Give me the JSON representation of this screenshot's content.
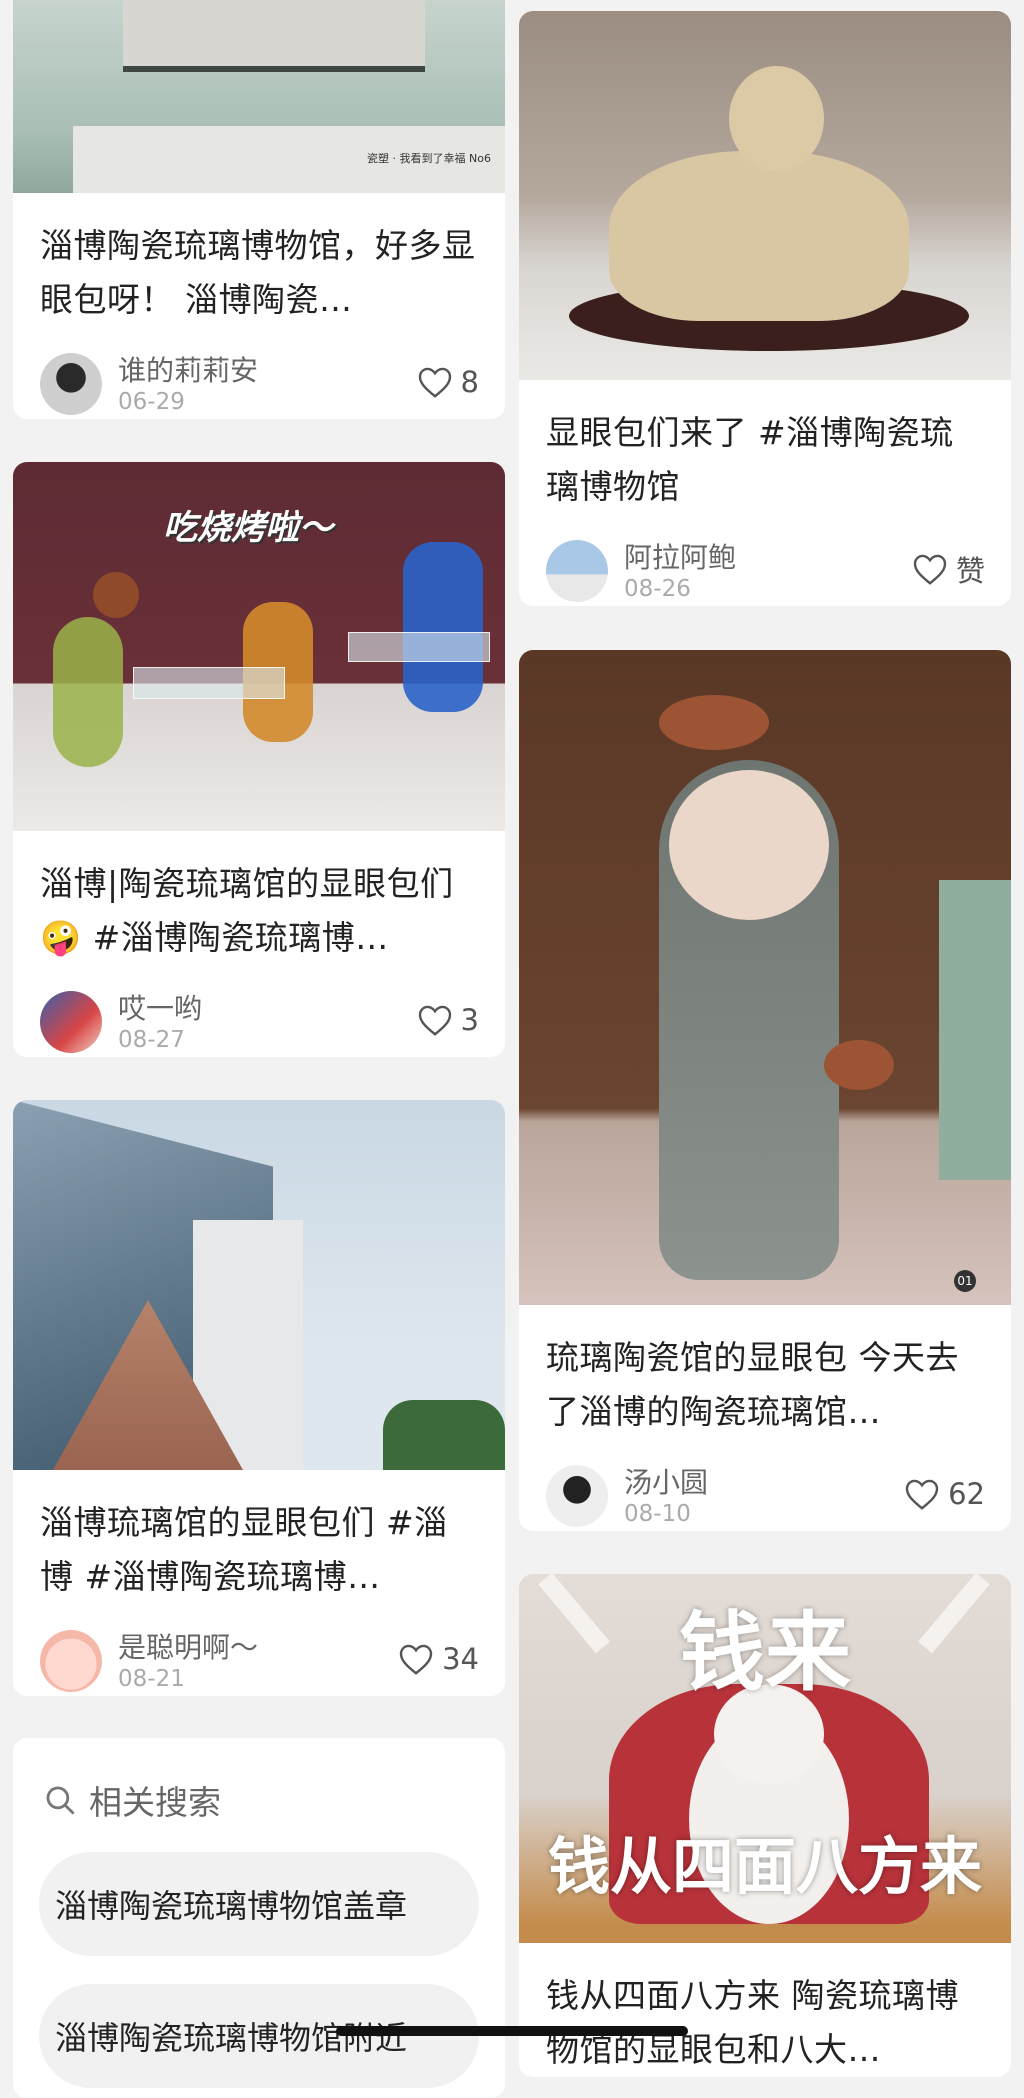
{
  "cards": {
    "c1": {
      "title": "淄博陶瓷琉璃博物馆，好多显眼包呀！ 淄博陶瓷…",
      "user": "谁的莉莉安",
      "date": "06-29",
      "likes": "8",
      "image_caption": "瓷塑 · 我看到了幸福 No6"
    },
    "c2": {
      "title": "显眼包们来了 #淄博陶瓷琉璃博物馆",
      "user": "阿拉阿鲍",
      "date": "08-26",
      "likes": "赞"
    },
    "c3": {
      "title": "淄博|陶瓷琉璃馆的显眼包们🤪 #淄博陶瓷琉璃博…",
      "user": "哎一哟",
      "date": "08-27",
      "likes": "3",
      "image_overlay": "吃烧烤啦～"
    },
    "c4": {
      "title": "琉璃陶瓷馆的显眼包 今天去了淄博的陶瓷琉璃馆…",
      "user": "汤小圆",
      "date": "08-10",
      "likes": "62",
      "image_badge": "01"
    },
    "c5": {
      "title": "淄博琉璃馆的显眼包们 #淄博 #淄博陶瓷琉璃博…",
      "user": "是聪明啊～",
      "date": "08-21",
      "likes": "34"
    },
    "c6": {
      "title": "钱从四面八方来 陶瓷琉璃博物馆的显眼包和八大…",
      "image_overlay_top": "钱来",
      "image_overlay_bottom": "钱从四面八方来"
    }
  },
  "related": {
    "heading": "相关搜索",
    "items": [
      "淄博陶瓷琉璃博物馆盖章",
      "淄博陶瓷琉璃博物馆附近"
    ]
  },
  "icons": {
    "like": "heart-outline-icon",
    "search": "search-icon"
  }
}
